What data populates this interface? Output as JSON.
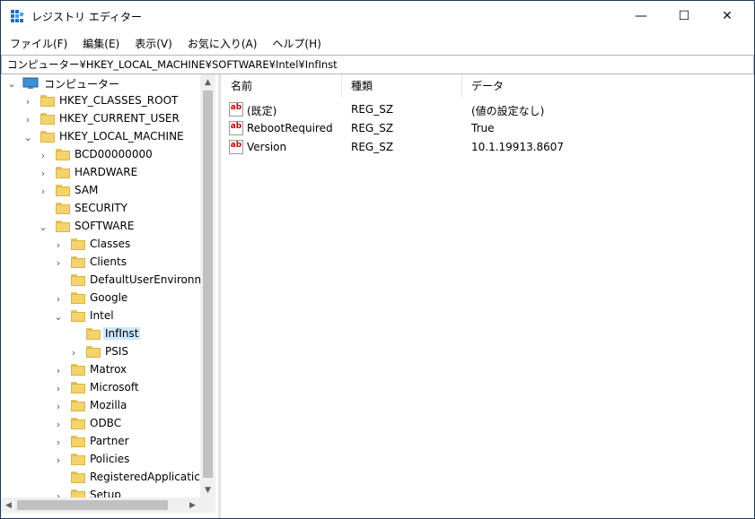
{
  "window": {
    "title": "レジストリ エディター",
    "controls": {
      "minimize": "—",
      "maximize": "☐",
      "close": "✕"
    }
  },
  "menu": [
    "ファイル(F)",
    "編集(E)",
    "表示(V)",
    "お気に入り(A)",
    "ヘルプ(H)"
  ],
  "address": "コンピューター¥HKEY_LOCAL_MACHINE¥SOFTWARE¥Intel¥InfInst",
  "tree": {
    "root_label": "コンピューター",
    "items": [
      {
        "label": "HKEY_CLASSES_ROOT",
        "chev": "›"
      },
      {
        "label": "HKEY_CURRENT_USER",
        "chev": "›"
      },
      {
        "label": "HKEY_LOCAL_MACHINE",
        "chev": "⌄"
      },
      {
        "label": "BCD00000000",
        "chev": "›"
      },
      {
        "label": "HARDWARE",
        "chev": "›"
      },
      {
        "label": "SAM",
        "chev": "›"
      },
      {
        "label": "SECURITY",
        "chev": ""
      },
      {
        "label": "SOFTWARE",
        "chev": "⌄"
      },
      {
        "label": "Classes",
        "chev": "›"
      },
      {
        "label": "Clients",
        "chev": "›"
      },
      {
        "label": "DefaultUserEnvironn",
        "chev": ""
      },
      {
        "label": "Google",
        "chev": "›"
      },
      {
        "label": "Intel",
        "chev": "⌄"
      },
      {
        "label": "InfInst",
        "chev": "",
        "selected": true
      },
      {
        "label": "PSIS",
        "chev": "›"
      },
      {
        "label": "Matrox",
        "chev": "›"
      },
      {
        "label": "Microsoft",
        "chev": "›"
      },
      {
        "label": "Mozilla",
        "chev": "›"
      },
      {
        "label": "ODBC",
        "chev": "›"
      },
      {
        "label": "Partner",
        "chev": "›"
      },
      {
        "label": "Policies",
        "chev": "›"
      },
      {
        "label": "RegisteredApplicatic",
        "chev": ""
      },
      {
        "label": "Setup",
        "chev": "›"
      }
    ]
  },
  "list": {
    "columns": {
      "name": "名前",
      "type": "種類",
      "data": "データ"
    },
    "rows": [
      {
        "name": "(既定)",
        "type": "REG_SZ",
        "data": "(値の設定なし)"
      },
      {
        "name": "RebootRequired",
        "type": "REG_SZ",
        "data": "True"
      },
      {
        "name": "Version",
        "type": "REG_SZ",
        "data": "10.1.19913.8607"
      }
    ],
    "value_icon": "ab"
  },
  "colors": {
    "selection": "#cce8ff",
    "folder": "#f3d36b",
    "ab_icon": "#c00000"
  }
}
